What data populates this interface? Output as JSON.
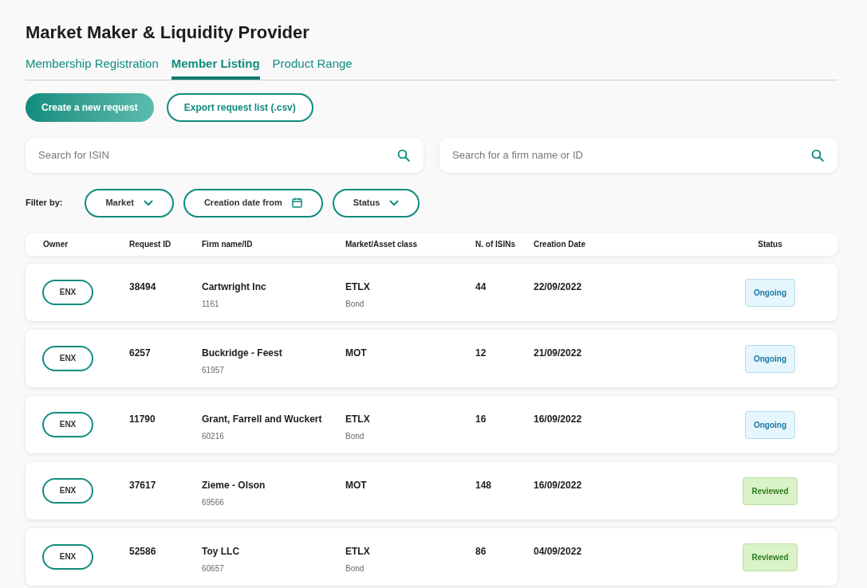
{
  "title": "Market Maker & Liquidity Provider",
  "tabs": [
    {
      "label": "Membership Registration",
      "selected": false
    },
    {
      "label": "Member Listing",
      "selected": true
    },
    {
      "label": "Product Range",
      "selected": false
    }
  ],
  "actions": [
    {
      "label": "Create a new request",
      "kind": "primary"
    },
    {
      "label": "Export request list (.csv)",
      "kind": "outline"
    }
  ],
  "searches": [
    {
      "placeholder": "Search for ISIN"
    },
    {
      "placeholder": "Search for a firm name or ID"
    }
  ],
  "filter": {
    "label": "Filter by:",
    "options": [
      {
        "label": "Market",
        "kind": "dropdown"
      },
      {
        "label": "Creation date from",
        "kind": "date"
      },
      {
        "label": "Status",
        "kind": "dropdown"
      }
    ]
  },
  "table": {
    "columns": [
      "Owner",
      "Request ID",
      "Firm name/ID",
      "Market/Asset class",
      "N. of ISINs",
      "Creation Date",
      "Status"
    ],
    "rows": [
      {
        "owner": "ENX",
        "request_id": "38494",
        "firm_name": "Cartwright Inc",
        "firm_id": "1161",
        "market": "ETLX",
        "asset_class": "Bond",
        "isins": "44",
        "date": "22/09/2022",
        "status": "Ongoing",
        "kind": "ongoing"
      },
      {
        "owner": "ENX",
        "request_id": "6257",
        "firm_name": "Buckridge - Feest",
        "firm_id": "61957",
        "market": "MOT",
        "isins": "12",
        "date": "21/09/2022",
        "status": "Ongoing",
        "kind": "ongoing"
      },
      {
        "owner": "ENX",
        "request_id": "11790",
        "firm_name": "Grant, Farrell and Wuckert",
        "firm_id": "60216",
        "market": "ETLX",
        "asset_class": "Bond",
        "isins": "16",
        "date": "16/09/2022",
        "status": "Ongoing",
        "kind": "ongoing"
      },
      {
        "owner": "ENX",
        "request_id": "37617",
        "firm_name": "Zieme - Olson",
        "firm_id": "69566",
        "market": "MOT",
        "isins": "148",
        "date": "16/09/2022",
        "status": "Reviewed",
        "kind": "reviewed"
      },
      {
        "owner": "ENX",
        "request_id": "52586",
        "firm_name": "Toy LLC",
        "firm_id": "60657",
        "market": "ETLX",
        "asset_class": "Bond",
        "isins": "86",
        "date": "04/09/2022",
        "status": "Reviewed",
        "kind": "reviewed"
      }
    ]
  }
}
